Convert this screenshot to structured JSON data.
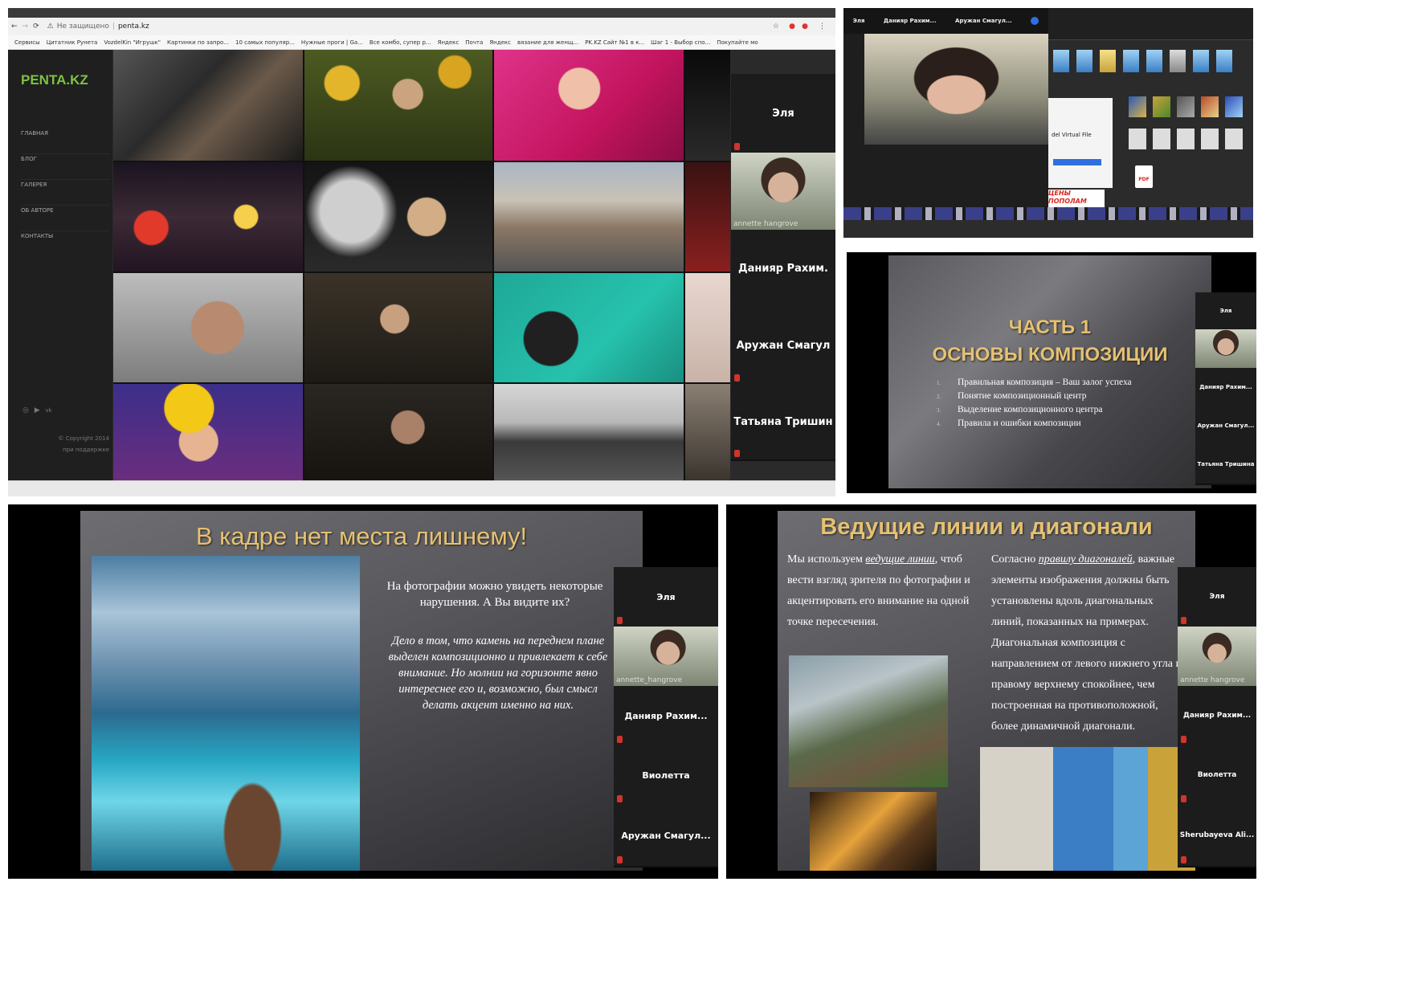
{
  "browser": {
    "security": "Не защищено",
    "url": "penta.kz",
    "bookmarks": [
      "Сервисы",
      "Цитатник Рунета",
      "VozdelKin \"Игрушк\"",
      "Картинки по запро...",
      "10 самых популяр...",
      "Нужные проги | Ga...",
      "Все комбо, супер р...",
      "Яндекс",
      "Почта",
      "Яндекс",
      "вязание для женщ...",
      "PK.KZ Сайт №1 в к...",
      "Шаг 1 - Выбор спо...",
      "Покупайте мо"
    ]
  },
  "site": {
    "logo": "PENTA.KZ",
    "nav": [
      "ГЛАВНАЯ",
      "БЛОГ",
      "ГАЛЕРЕЯ",
      "ОБ АВТОРЕ",
      "КОНТАКТЫ"
    ],
    "copyright": "© Copyright 2014",
    "support": "при поддержке"
  },
  "participants_panel1": [
    "Эля",
    "Данияр Рахим.",
    "Аружан Смагул",
    "Татьяна Тришин"
  ],
  "video_caption_1": "annette hangrove",
  "panel2": {
    "top_names": [
      "Эля",
      "Данияр Рахим...",
      "Аружан Смагул..."
    ],
    "virtual_file": "del Virtual File",
    "ad_text": "ЦЕНЫ ПОПОЛАМ",
    "pdf_label": "PDF"
  },
  "slide1": {
    "title_line1": "ЧАСТЬ 1",
    "title_line2": "ОСНОВЫ КОМПОЗИЦИИ",
    "items": [
      {
        "num": "1.",
        "text": "Правильная композиция – Ваш залог успеха"
      },
      {
        "num": "2.",
        "text": "Понятие композиционный центр"
      },
      {
        "num": "3.",
        "text": "Выделение композиционного центра"
      },
      {
        "num": "4.",
        "text": "Правила и ошибки композиции"
      }
    ],
    "participants": [
      "Эля",
      "Данияр Рахим...",
      "Аружан Смагул...",
      "Татьяна Тришина"
    ]
  },
  "slide2": {
    "title": "В кадре нет места лишнему!",
    "para1": "На фотографии можно увидеть некоторые нарушения. А Вы видите их?",
    "para2": "Дело в том, что камень на переднем плане выделен композиционно и привлекает к себе внимание. Но молнии на горизонте явно интереснее его и, возможно, был смысл делать акцент именно на них.",
    "participants": [
      "Эля",
      "Данияр Рахим...",
      "Виолетта",
      "Аружан Смагул..."
    ],
    "video_caption": "annette_hangrove"
  },
  "slide3": {
    "title": "Ведущие линии и диагонали",
    "left_pre": "Мы используем ",
    "left_link": "ведущие линии",
    "left_post": ", чтоб вести взгляд зрителя по фотографии и акцентировать его внимание на одной точке пересечения.",
    "right_pre": "Согласно ",
    "right_link": "правилу диагоналей",
    "right_post": ", важные элементы изображения должны быть установлены вдоль диагональных линий, показанных на примерах. Диагональная композиция с направлением от левого нижнего угла к правому верхнему спокойнее, чем построенная на противоположной, более динамичной диагонали.",
    "participants": [
      "Эля",
      "Данияр Рахим...",
      "Виолетта",
      "Sherubayeva Ali..."
    ],
    "video_caption": "annette hangrove"
  },
  "colors": {
    "title_gold": "#e6c173",
    "site_logo_green": "#7dc242",
    "tile_dark": "#1c1c1c"
  }
}
